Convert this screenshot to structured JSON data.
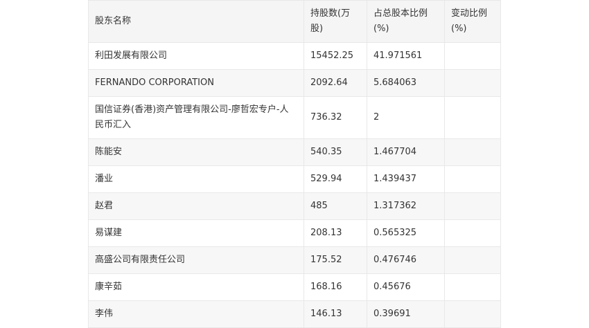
{
  "table": {
    "headers": [
      "股东名称",
      "持股数(万股)",
      "占总股本比例(%)",
      "变动比例(%)"
    ],
    "rows": [
      {
        "name": "利田发展有限公司",
        "shares": "15452.25",
        "ratio": "41.971561",
        "change": ""
      },
      {
        "name": "FERNANDO CORPORATION",
        "shares": "2092.64",
        "ratio": "5.684063",
        "change": ""
      },
      {
        "name": "国信证券(香港)资产管理有限公司-廖哲宏专户-人民币汇入",
        "shares": "736.32",
        "ratio": "2",
        "change": ""
      },
      {
        "name": "陈能安",
        "shares": "540.35",
        "ratio": "1.467704",
        "change": ""
      },
      {
        "name": "潘业",
        "shares": "529.94",
        "ratio": "1.439437",
        "change": ""
      },
      {
        "name": "赵君",
        "shares": "485",
        "ratio": "1.317362",
        "change": ""
      },
      {
        "name": "易谋建",
        "shares": "208.13",
        "ratio": "0.565325",
        "change": ""
      },
      {
        "name": "高盛公司有限责任公司",
        "shares": "175.52",
        "ratio": "0.476746",
        "change": ""
      },
      {
        "name": "康辛茹",
        "shares": "168.16",
        "ratio": "0.45676",
        "change": ""
      },
      {
        "name": "李伟",
        "shares": "146.13",
        "ratio": "0.39691",
        "change": ""
      }
    ]
  }
}
